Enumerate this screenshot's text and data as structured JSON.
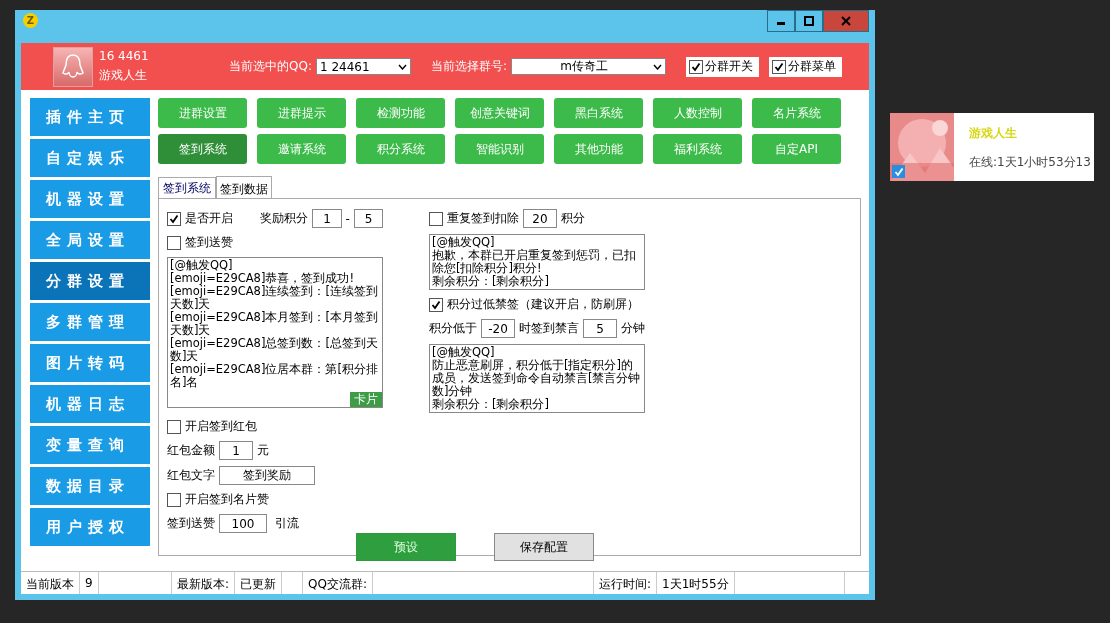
{
  "window": {
    "app_icon": "Z"
  },
  "header": {
    "qq": "16 4461",
    "nickname": "游戏人生",
    "selected_qq_label": "当前选中的QQ:",
    "selected_qq": "1 24461",
    "group_label": "当前选择群号:",
    "group": "m传奇工",
    "toggles": [
      {
        "label": "分群开关",
        "checked": true
      },
      {
        "label": "分群菜单",
        "checked": true
      }
    ]
  },
  "sidebar": {
    "items": [
      {
        "label": "插件主页",
        "selected": false
      },
      {
        "label": "自定娱乐",
        "selected": false
      },
      {
        "label": "机器设置",
        "selected": false
      },
      {
        "label": "全局设置",
        "selected": false
      },
      {
        "label": "分群设置",
        "selected": true
      },
      {
        "label": "多群管理",
        "selected": false
      },
      {
        "label": "图片转码",
        "selected": false
      },
      {
        "label": "机器日志",
        "selected": false
      },
      {
        "label": "变量查询",
        "selected": false
      },
      {
        "label": "数据目录",
        "selected": false
      },
      {
        "label": "用户授权",
        "selected": false
      }
    ]
  },
  "modules": [
    {
      "label": "进群设置",
      "selected": false
    },
    {
      "label": "进群提示",
      "selected": false
    },
    {
      "label": "检测功能",
      "selected": false
    },
    {
      "label": "创意关键词",
      "selected": false
    },
    {
      "label": "黑白系统",
      "selected": false
    },
    {
      "label": "人数控制",
      "selected": false
    },
    {
      "label": "名片系统",
      "selected": false
    },
    {
      "label": "签到系统",
      "selected": true
    },
    {
      "label": "邀请系统",
      "selected": false
    },
    {
      "label": "积分系统",
      "selected": false
    },
    {
      "label": "智能识别",
      "selected": false
    },
    {
      "label": "其他功能",
      "selected": false
    },
    {
      "label": "福利系统",
      "selected": false
    },
    {
      "label": "自定API",
      "selected": false
    }
  ],
  "tabs": [
    {
      "label": "签到系统",
      "selected": true
    },
    {
      "label": "签到数据",
      "selected": false
    }
  ],
  "left": {
    "enable": {
      "label": "是否开启",
      "checked": true
    },
    "reward_label": "奖励积分",
    "reward_min": "1",
    "dash": "-",
    "reward_max": "5",
    "like": {
      "label": "签到送赞",
      "checked": false
    },
    "message": [
      "[@触发QQ]",
      "[emoji=E29CA8]恭喜，签到成功!",
      "[emoji=E29CA8]连续签到：[连续签到天数]天",
      "[emoji=E29CA8]本月签到：[本月签到天数]天",
      "[emoji=E29CA8]总签到数：[总签到天数]天",
      "[emoji=E29CA8]位居本群：第[积分排名]名"
    ],
    "card_label": "卡片",
    "redpacket": {
      "label": "开启签到红包",
      "checked": false
    },
    "amount_label": "红包金额",
    "amount": "1",
    "amount_unit": "元",
    "text_label": "红包文字",
    "text": "签到奖励",
    "card_like": {
      "label": "开启签到名片赞",
      "checked": false
    },
    "likes_label": "签到送赞",
    "likes": "100",
    "likes_unit": "引流"
  },
  "right": {
    "repeat": {
      "label": "重复签到扣除",
      "checked": false
    },
    "repeat_points": "20",
    "repeat_unit": "积分",
    "repeat_message": [
      "[@触发QQ]",
      "抱歉，本群已开启重复签到惩罚，已扣除您[扣除积分]积分!",
      "剩余积分：[剩余积分]"
    ],
    "low": {
      "label": "积分过低禁签（建议开启，防刷屏）",
      "checked": true
    },
    "low_prefix": "积分低于",
    "low_points": "-20",
    "low_mid": "时签到禁言",
    "low_minutes": "5",
    "low_unit": "分钟",
    "low_message": [
      "[@触发QQ]",
      "防止恶意刷屏，积分低于[指定积分]的成员，发送签到命令自动禁言[禁言分钟数]分钟",
      "剩余积分：[剩余积分]"
    ]
  },
  "buttons": [
    {
      "label": "预设",
      "kind": "primary"
    },
    {
      "label": "保存配置",
      "kind": "plain"
    }
  ],
  "status_bar": [
    {
      "label": "当前版本",
      "value": "9"
    },
    {
      "label": "最新版本:",
      "value": "已更新"
    },
    {
      "label": "QQ交流群:"
    },
    {
      "label": "运行时间:",
      "value": "1天1时55分"
    }
  ],
  "notification": {
    "name": "游戏人生",
    "status": "在线:1天1小时53分13",
    "checked": true
  }
}
